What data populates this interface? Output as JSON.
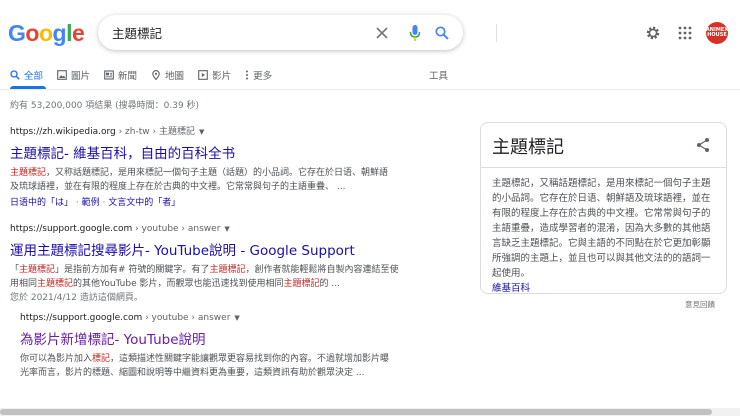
{
  "logo": {
    "letters": [
      "G",
      "o",
      "o",
      "g",
      "l",
      "e"
    ],
    "colors": [
      "#4285F4",
      "#EA4335",
      "#FBBC05",
      "#4285F4",
      "#34A853",
      "#EA4335"
    ]
  },
  "search": {
    "value": "主題標記"
  },
  "avatar": {
    "text": "ANIMEX HOUSE"
  },
  "tabs": [
    {
      "label": "全部",
      "icon": "search-icon",
      "active": true
    },
    {
      "label": "圖片",
      "icon": "image-icon"
    },
    {
      "label": "新聞",
      "icon": "news-icon"
    },
    {
      "label": "地圖",
      "icon": "map-pin-icon"
    },
    {
      "label": "影片",
      "icon": "play-icon"
    },
    {
      "label": "更多",
      "icon": "more-vert-icon"
    }
  ],
  "tools_label": "工具",
  "stats": "約有 53,200,000 項結果 (搜尋時間：0.39 秒)",
  "results": [
    {
      "domain": "https://zh.wikipedia.org",
      "path": " › zh-tw › 主題標記",
      "title": "主題標記- 維基百科，自由的百科全书",
      "snippet_em1": "主題標記",
      "snippet_line1": "，又称話題標記，是用來標記一個句子主題（話題）的小品詞。它存在於日语、朝鮮語",
      "snippet_line2": "及琉球語裡，並在有限的程度上存在於古典的中文裡。它常常與句子的主語重疊、 ...",
      "sitelinks": [
        "日语中的「は」",
        "範例",
        "文言文中的「者」"
      ]
    },
    {
      "domain": "https://support.google.com",
      "path": " › youtube › answer",
      "title": "運用主題標記搜尋影片- YouTube說明 - Google Support",
      "s_a": "「",
      "s_em1": "主題標記",
      "s_b": "」是指前方加有# 符號的關鍵字。有了",
      "s_em2": "主題標記",
      "s_c": "，創作者就能輕鬆將自製內容連結至使",
      "s_d": "用相同",
      "s_em3": "主題標記",
      "s_e": "的其他YouTube 影片，而觀眾也能迅速找到使用相同",
      "s_em4": "主題標記",
      "s_f": "的 ...",
      "visited": "您於 2021/4/12 造訪這個網頁。"
    },
    {
      "domain": "https://support.google.com",
      "path": " › youtube › answer",
      "title": "為影片新增標記- YouTube說明",
      "s_a": "你可以為影片加入",
      "s_em1": "標記",
      "s_b": "，這類描述性關鍵字能讓觀眾更容易找到你的內容。不過就增加影片曝",
      "s_line2": "光率而言，影片的標題、縮圖和說明等中繼資料更為重要，這類資訊有助於觀眾決定 ..."
    }
  ],
  "knowledge_panel": {
    "title": "主題標記",
    "description": "主題標記，又稱話題標記，是用來標記一個句子主題的小品詞。它存在於日语、朝鮮語及琉球語裡，並在有限的程度上存在於古典的中文裡。它常常與句子的主語重疊，造成學習者的混淆，因為大多數的其他語言缺乏主題標記。它與主語的不同點在於它更加彰顯所強調的主題上，並且也可以與其他文法的的語詞一起使用。",
    "source": "維基百科"
  },
  "feedback": "意見回饋"
}
